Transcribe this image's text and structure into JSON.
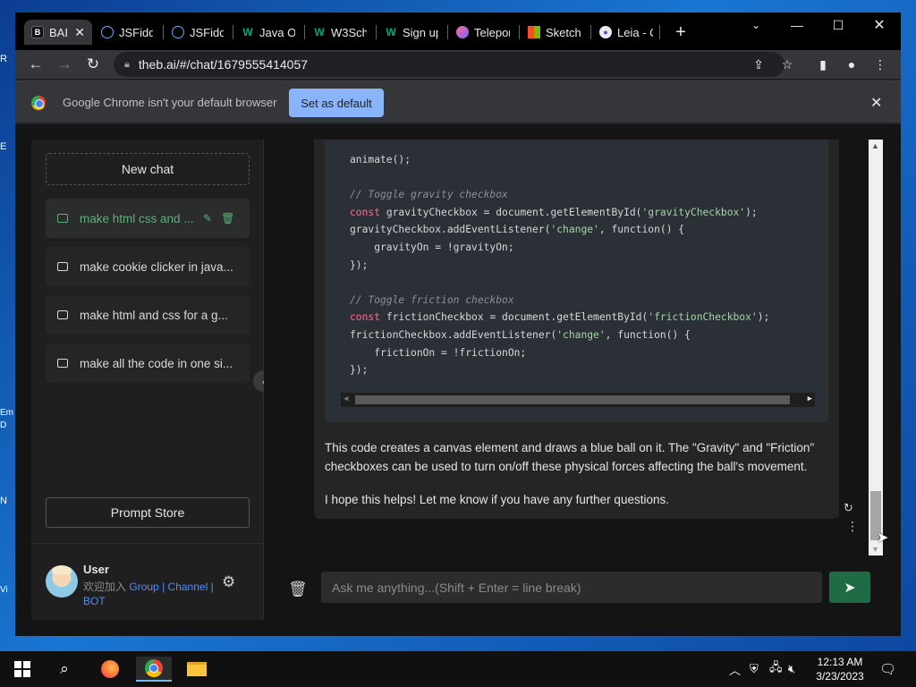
{
  "desktop": {
    "icon_labels": [
      "R",
      "E",
      "Em",
      "D",
      "N",
      "Vi"
    ]
  },
  "browser": {
    "tabs": [
      {
        "title": "BAI",
        "active": true,
        "favicon": "bai-icon",
        "close": "✕"
      },
      {
        "title": "JSFiddl",
        "favicon": "jsfiddle-icon"
      },
      {
        "title": "JSFiddl",
        "favicon": "jsfiddle-icon"
      },
      {
        "title": "Java Or",
        "favicon": "w3schools-icon"
      },
      {
        "title": "W3Sch",
        "favicon": "w3schools-icon"
      },
      {
        "title": "Sign up",
        "favicon": "w3schools-icon"
      },
      {
        "title": "Telepor",
        "favicon": "teleport-icon"
      },
      {
        "title": "Sketch",
        "favicon": "microsoft-icon"
      },
      {
        "title": "Leia - C",
        "favicon": "leia-icon"
      }
    ],
    "new_tab": "+",
    "url": "theb.ai/#/chat/1679555414057",
    "infobar": {
      "message": "Google Chrome isn't your default browser",
      "button": "Set as default",
      "close": "✕"
    }
  },
  "sidebar": {
    "new_chat": "New chat",
    "chats": [
      {
        "label": "make html css and ...",
        "active": true
      },
      {
        "label": "make cookie clicker in java..."
      },
      {
        "label": "make html and css for a g..."
      },
      {
        "label": "make all the code in one si..."
      }
    ],
    "prompt_store": "Prompt Store",
    "user": {
      "name": "User",
      "prefix": "欢迎加入",
      "links": [
        "Group",
        "Channel",
        "BOT"
      ],
      "sep": "|"
    }
  },
  "chat": {
    "code_lines": [
      {
        "parts": [
          [
            "",
            "animate();"
          ]
        ]
      },
      {
        "parts": []
      },
      {
        "parts": [
          [
            "cm",
            "// Toggle gravity checkbox"
          ]
        ]
      },
      {
        "parts": [
          [
            "kw",
            "const"
          ],
          [
            "",
            " gravityCheckbox = document.getElementById("
          ],
          [
            "str",
            "'gravityCheckbox'"
          ],
          [
            "",
            ");"
          ]
        ]
      },
      {
        "parts": [
          [
            "",
            "gravityCheckbox.addEventListener("
          ],
          [
            "str",
            "'change'"
          ],
          [
            "",
            ", function() {"
          ]
        ]
      },
      {
        "parts": [
          [
            "",
            "    gravityOn = !gravityOn;"
          ]
        ]
      },
      {
        "parts": [
          [
            "",
            "});"
          ]
        ]
      },
      {
        "parts": []
      },
      {
        "parts": [
          [
            "cm",
            "// Toggle friction checkbox"
          ]
        ]
      },
      {
        "parts": [
          [
            "kw",
            "const"
          ],
          [
            "",
            " frictionCheckbox = document.getElementById("
          ],
          [
            "str",
            "'frictionCheckbox'"
          ],
          [
            "",
            ");"
          ]
        ]
      },
      {
        "parts": [
          [
            "",
            "frictionCheckbox.addEventListener("
          ],
          [
            "str",
            "'change'"
          ],
          [
            "",
            ", function() {"
          ]
        ]
      },
      {
        "parts": [
          [
            "",
            "    frictionOn = !frictionOn;"
          ]
        ]
      },
      {
        "parts": [
          [
            "",
            "});"
          ]
        ]
      }
    ],
    "paragraph1": "This code creates a canvas element and draws a blue ball on it. The \"Gravity\" and \"Friction\" checkboxes can be used to turn on/off these physical forces affecting the ball's movement.",
    "paragraph2": "I hope this helps! Let me know if you have any further questions.",
    "input_placeholder": "Ask me anything...(Shift + Enter = line break)"
  },
  "taskbar": {
    "time": "12:13 AM",
    "date": "3/23/2023"
  },
  "colors": {
    "accent_green": "#5fae7a",
    "send_button": "#1e6b46",
    "link_blue": "#4f8df7",
    "set_default_button": "#8ab4f8"
  }
}
